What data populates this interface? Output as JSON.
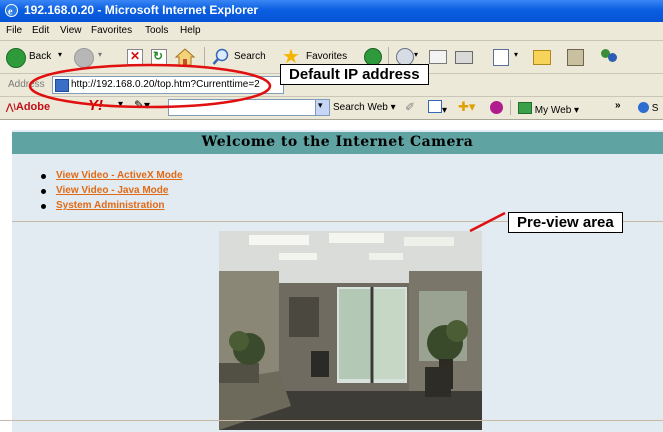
{
  "window": {
    "title": "192.168.0.20 - Microsoft Internet Explorer"
  },
  "menu": {
    "items": [
      "File",
      "Edit",
      "View",
      "Favorites",
      "Tools",
      "Help"
    ]
  },
  "toolbar": {
    "back_label": "Back",
    "search_label": "Search",
    "favorites_label": "Favorites"
  },
  "address": {
    "label": "Address",
    "url": "http://192.168.0.20/top.htm?Currenttime=2"
  },
  "search_toolbar": {
    "adobe_label": "Adobe",
    "yahoo_label": "Y!",
    "search_web_label": "Search Web",
    "my_web_label": "My Web",
    "overflow_label": "»",
    "trailing_label": "S"
  },
  "page": {
    "heading": "Welcome to the Internet Camera",
    "links": [
      "View Video - ActiveX Mode",
      "View Video - Java Mode",
      "System Administration"
    ]
  },
  "annotations": {
    "ip_callout": "Default IP address",
    "preview_callout": "Pre-view area"
  },
  "colors": {
    "titlebar": "#0a5fe0",
    "chrome": "#ece9d8",
    "welcome_bar": "#5fa3a3",
    "panel": "#e2ebf2",
    "link": "#e06a16",
    "annotation": "#e01010"
  }
}
